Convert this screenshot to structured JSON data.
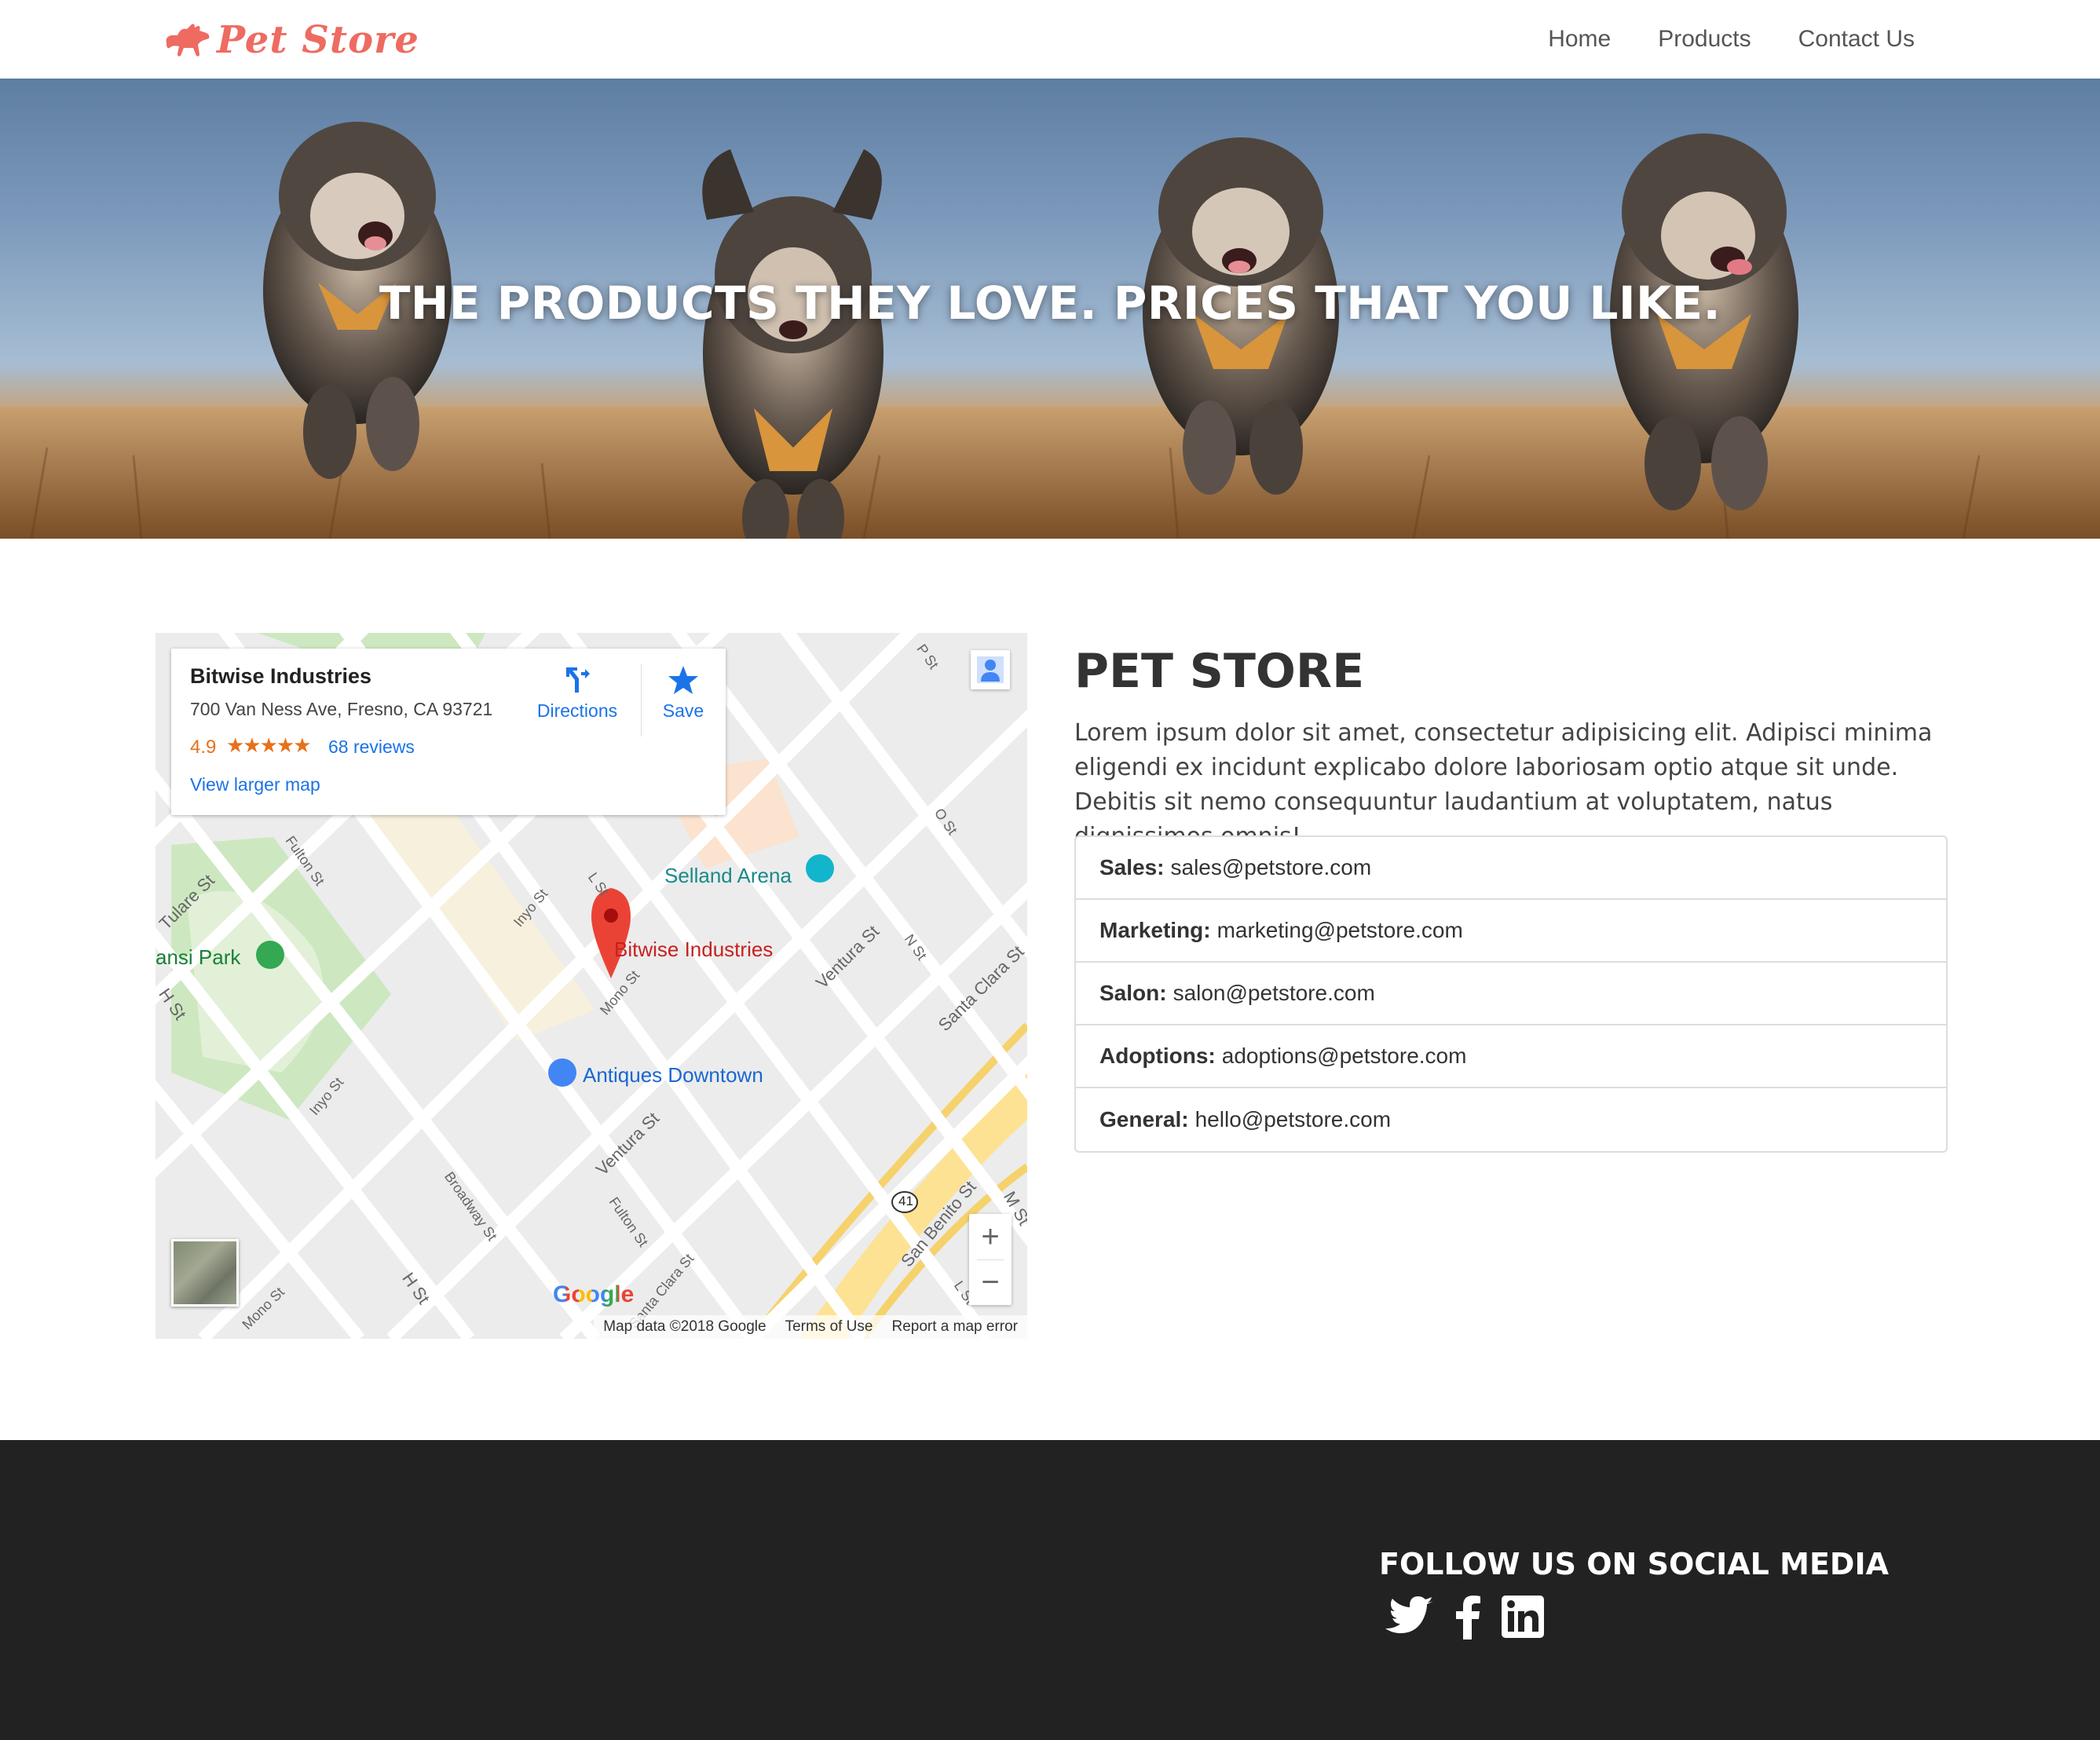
{
  "nav": {
    "brand": "Pet Store",
    "links": [
      "Home",
      "Products",
      "Contact Us"
    ]
  },
  "hero": {
    "title": "THE PRODUCTS THEY LOVE. PRICES THAT YOU LIKE."
  },
  "map": {
    "place_name": "Bitwise Industries",
    "address": "700 Van Ness Ave, Fresno, CA 93721",
    "rating": "4.9",
    "stars": "★★★★★",
    "reviews": "68 reviews",
    "view_larger": "View larger map",
    "directions": "Directions",
    "save": "Save",
    "labels": {
      "selland": "Selland Arena",
      "bitwise": "Bitwise Industries",
      "antiques": "Antiques Downtown",
      "park": "ansi Park"
    },
    "streets": [
      "P St",
      "O St",
      "N St",
      "L St",
      "Inyo St",
      "Fulton St",
      "Tulare St",
      "H St",
      "Mono St",
      "Ventura St",
      "Santa Clara St",
      "Broadway St",
      "San Benito St",
      "M St",
      "L St",
      "Mono St",
      "H St",
      "Fulton St",
      "Santa Clara St",
      "Ventura St",
      "Inyo St"
    ],
    "highway": "41",
    "google": "Google",
    "footer": [
      "Map data ©2018 Google",
      "Terms of Use",
      "Report a map error"
    ],
    "zoom_in": "+",
    "zoom_out": "−"
  },
  "store": {
    "title": "PET STORE",
    "description": "Lorem ipsum dolor sit amet, consectetur adipisicing elit. Adipisci minima eligendi ex incidunt explicabo dolore laboriosam optio atque sit unde. Debitis sit nemo consequuntur laudantium at voluptatem, natus dignissimos omnis!",
    "contacts": [
      {
        "label": "Sales:",
        "email": "sales@petstore.com"
      },
      {
        "label": "Marketing:",
        "email": "marketing@petstore.com"
      },
      {
        "label": "Salon:",
        "email": "salon@petstore.com"
      },
      {
        "label": "Adoptions:",
        "email": "adoptions@petstore.com"
      },
      {
        "label": "General:",
        "email": "hello@petstore.com"
      }
    ]
  },
  "footer": {
    "follow": "FOLLOW US ON SOCIAL MEDIA",
    "icons": [
      "twitter-icon",
      "facebook-icon",
      "linkedin-icon"
    ]
  },
  "colors": {
    "brand": "#ee6b61",
    "footer_bg": "#222222",
    "map_link": "#1a73e8",
    "rating": "#e7711b"
  }
}
